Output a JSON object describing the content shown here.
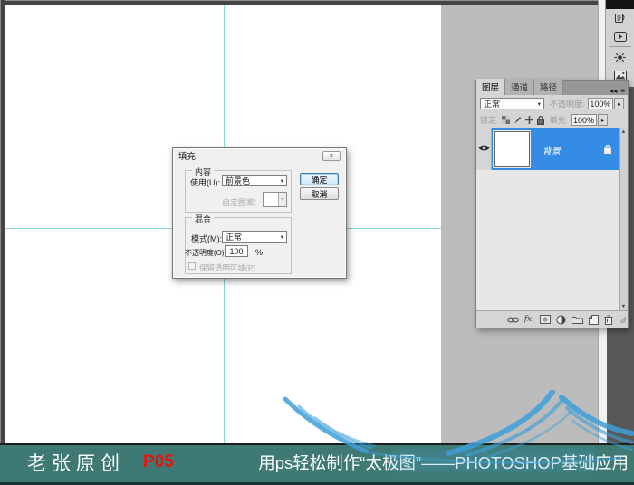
{
  "colors": {
    "caption_teal": "#3e7a73",
    "code_red": "#e8130c",
    "guide_cyan": "#86d8d4",
    "selection_blue": "#348ce4",
    "watermark_blue": "#3d9fd8"
  },
  "glyphs": {
    "dropdown": "▾",
    "spinner": "▸",
    "scroll_up": "▲",
    "scroll_down": "▼",
    "collapse": "◂◂",
    "panel_menu": "≡",
    "close": "×",
    "fx": "fx."
  },
  "fill_dialog": {
    "title": "填充",
    "content_group": {
      "label": "内容",
      "use_label": "使用(U):",
      "use_value": "前景色",
      "custom_pattern_label": "自定图案:"
    },
    "blend_group": {
      "label": "混合",
      "mode_label": "模式(M):",
      "mode_value": "正常",
      "opacity_label": "不透明度(O):",
      "opacity_value": "100",
      "percent": "%",
      "preserve_label": "保留透明区域(P)"
    },
    "ok": "确定",
    "cancel": "取消"
  },
  "layers_panel": {
    "tabs": [
      {
        "label": "图层"
      },
      {
        "label": "通道"
      },
      {
        "label": "路径"
      }
    ],
    "blend_mode_value": "正常",
    "opacity_label": "不透明度:",
    "opacity_value": "100%",
    "lock_label": "锁定:",
    "fill_label": "填充:",
    "fill_value": "100%",
    "layer": {
      "name": "背景"
    }
  },
  "caption_bar": {
    "author": "老张原创",
    "code": "P05",
    "title": "用ps轻松制作“太极图”——PHOTOSHOP基础应用"
  }
}
